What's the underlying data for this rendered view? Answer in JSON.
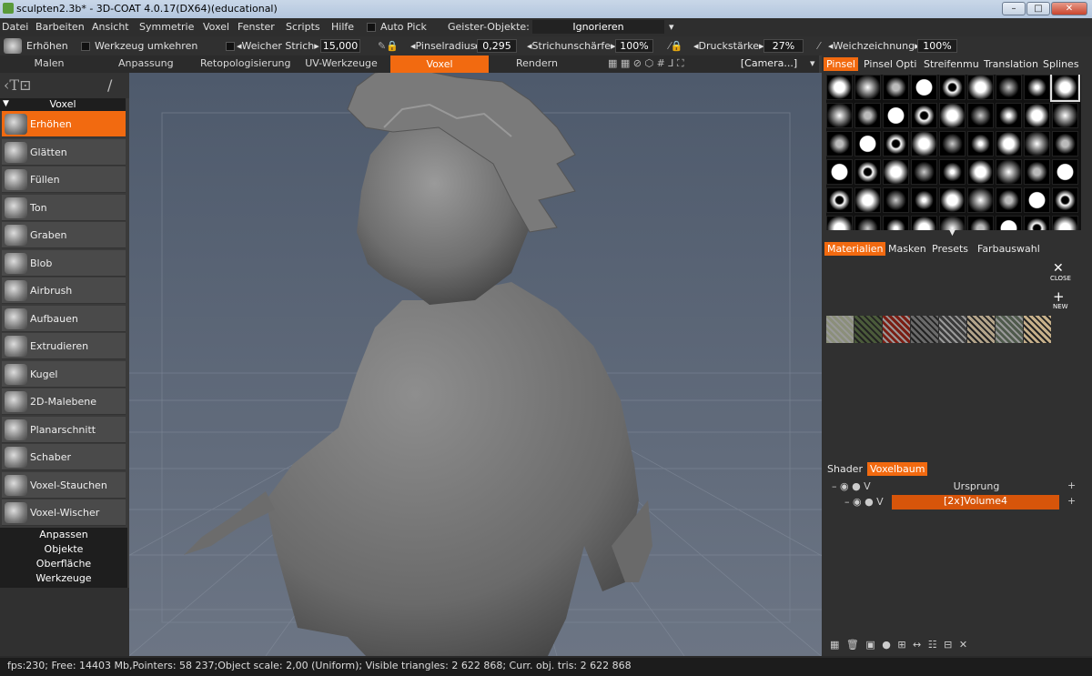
{
  "title": "sculpten2.3b* - 3D-COAT 4.0.17(DX64)(educational)",
  "menu": [
    "Datei",
    "Barbeiten",
    "Ansicht",
    "Symmetrie",
    "Voxel",
    "Fenster",
    "Scripts",
    "Hilfe",
    "Auto Pick",
    "Geister-Objekte:",
    "Ignorieren"
  ],
  "toolbar": {
    "raise": "Erhöhen",
    "invert": "Werkzeug umkehren",
    "soft_stroke": "◂Weicher Strich▸",
    "soft_stroke_val": "15,000",
    "brush_radius": "◂Pinselradius▸",
    "brush_radius_val": "0,295",
    "stroke_sharp": "◂Strichunschärfe▸",
    "stroke_sharp_val": "100%",
    "pressure": "◂Druckstärke▸",
    "pressure_val": "27%",
    "smoothing": "◂Weichzeichnung▸",
    "smoothing_val": "100%"
  },
  "tabs": [
    "Malen",
    "Anpassung",
    "Retopologisierung",
    "UV-Werkzeuge",
    "Voxel",
    "Rendern"
  ],
  "camera": "[Camera...]",
  "left": {
    "header": "Voxel",
    "tools": [
      "Erhöhen",
      "Glätten",
      "Füllen",
      "Ton",
      "Graben",
      "Blob",
      "Airbrush",
      "Aufbauen",
      "Extrudieren",
      "Kugel",
      "2D-Malebene",
      "Planarschnitt",
      "Schaber",
      "Voxel-Stauchen",
      "Voxel-Wischer"
    ],
    "sections": [
      "Anpassen",
      "Objekte",
      "Oberfläche",
      "Werkzeuge"
    ]
  },
  "right": {
    "brush_tabs": [
      "Pinsel",
      "Pinsel Opti",
      "Streifenmu",
      "Translation",
      "Splines"
    ],
    "mat_tabs": [
      "Materialien",
      "Masken",
      "Presets",
      "Farbauswahl"
    ],
    "close": "CLOSE",
    "new": "NEW",
    "tree_tabs": [
      "Shader",
      "Voxelbaum"
    ],
    "tree": [
      "Ursprung",
      "[2x]Volume4"
    ]
  },
  "status": "fps:230;  Free: 14403 Mb,Pointers: 58 237;Object scale: 2,00 (Uniform); Visible triangles: 2 622 868; Curr. obj. tris: 2 622 868",
  "colors": {
    "accent": "#f26a10",
    "viewport": "#5c6677"
  }
}
